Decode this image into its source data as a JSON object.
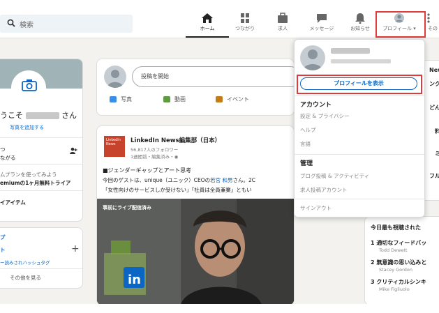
{
  "nav": {
    "search_placeholder": "検索",
    "items": [
      {
        "label": "ホーム",
        "icon": "home-icon"
      },
      {
        "label": "つながり",
        "icon": "network-icon"
      },
      {
        "label": "求人",
        "icon": "jobs-icon"
      },
      {
        "label": "メッセージ",
        "icon": "messaging-icon"
      },
      {
        "label": "お知らせ",
        "icon": "bell-icon"
      },
      {
        "label": "プロフィール ▾",
        "icon": "profile-avatar-icon"
      },
      {
        "label": "その",
        "icon": "grid-icon"
      }
    ]
  },
  "left_card": {
    "welcome_prefix": "うこそ",
    "welcome_suffix": "さん",
    "add_photo": "写真を追加する",
    "line1": "つ",
    "line2": "ながる",
    "premium1": "ムプランを使ってみよう",
    "premium2": "emiumの1ヶ月無料トライア",
    "my_items": "イアイテム",
    "groups": "プ",
    "events": "ト",
    "hashtags": "ー読みされハッシュタグ",
    "see_more": "その他を見る"
  },
  "post_box": {
    "placeholder": "投稿を開始",
    "actions": [
      "写真",
      "動画",
      "イベント"
    ]
  },
  "feed_post": {
    "logo_text": "LinkedIn News",
    "author": "LinkedIn News編集部（日本）",
    "followers": "56,817人のフォロワー",
    "time": "1週間前・編集済み・",
    "headline": "■ジェンダーギャップとアート思考",
    "body1_pre": "今回のゲストは、unique（ユニック）CEOの",
    "body1_link": "若宮 和男",
    "body1_post": "さん。2C",
    "body2": "「女性向けのサービスしか受けない」「社員は全員兼業」ともい",
    "video_label": "事前にライブ配信済み"
  },
  "dropdown": {
    "view_profile": "プロフィールを表示",
    "account_heading": "アカウント",
    "account_items": [
      "設定 & プライバシー",
      "ヘルプ",
      "言語"
    ],
    "manage_heading": "管理",
    "manage_items": [
      "ブログ投稿 & アクティビティ",
      "求人投稿アカウント"
    ],
    "sign_out": "サインアウト"
  },
  "right": {
    "news_title": "News編",
    "news_items": [
      "ンクト",
      "どんな",
      "料",
      "ミ",
      "フル"
    ],
    "courses_title": "今日最も視聴された",
    "courses": [
      {
        "title": "1 通切なフィードバッ",
        "author": "Todd Dewett"
      },
      {
        "title": "2 無意識の思い込みと",
        "author": "Stacey Gordon"
      },
      {
        "title": "3 クリティカルシンキ",
        "author": "Mike Figliuolo"
      }
    ]
  },
  "colors": {
    "highlight_border": "#e03a3a",
    "link_blue": "#0a66c2",
    "news_logo": "#c8432b"
  }
}
